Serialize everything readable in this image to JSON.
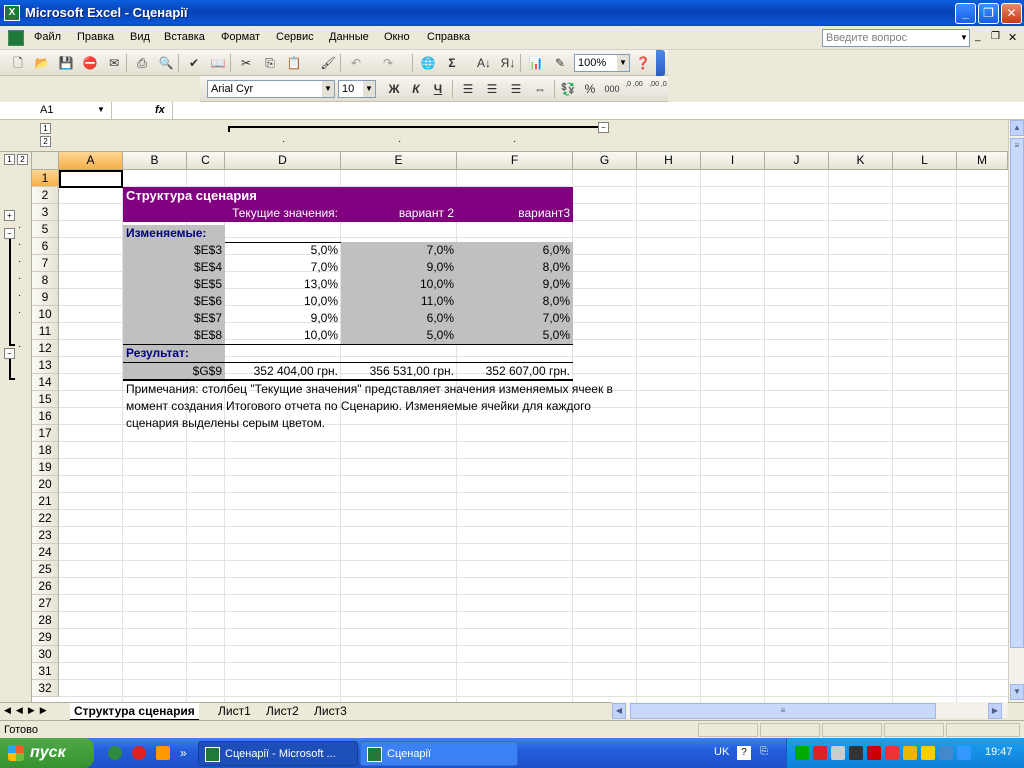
{
  "window": {
    "title": "Microsoft Excel - Сценарії",
    "app_icon": "excel-icon",
    "minimize": "_",
    "restore": "❐",
    "close": "✕"
  },
  "menu": {
    "items": [
      "Файл",
      "Правка",
      "Вид",
      "Вставка",
      "Формат",
      "Сервис",
      "Данные",
      "Окно",
      "Справка"
    ],
    "ask_placeholder": "Введите вопрос"
  },
  "toolbar": {
    "zoom": "100%",
    "font": "Arial Cyr",
    "size": "10",
    "bold": "Ж",
    "italic": "К",
    "underline": "Ч",
    "percent": "%",
    "thousands": "000",
    "inc_decimal": ",0 ,00",
    "dec_decimal": ",00 ,0",
    "sum": "Σ"
  },
  "formula_bar": {
    "name_box": "A1",
    "fx": "fx",
    "content": ""
  },
  "outline": {
    "levels_rows": [
      "1",
      "2"
    ],
    "levels_cols": [
      "1",
      "2"
    ],
    "expand": "+",
    "collapse": "−"
  },
  "columns": [
    "A",
    "B",
    "C",
    "D",
    "E",
    "F",
    "G",
    "H",
    "I",
    "J",
    "K",
    "L",
    "M"
  ],
  "rows": [
    "1",
    "2",
    "3",
    "5",
    "6",
    "7",
    "8",
    "9",
    "10",
    "11",
    "12",
    "13",
    "14",
    "15",
    "16",
    "17",
    "18",
    "19",
    "20",
    "21",
    "22",
    "23",
    "24",
    "25",
    "26",
    "27",
    "28",
    "29",
    "30",
    "31",
    "32"
  ],
  "sheet": {
    "title": "Структура сценария",
    "headers": [
      "Текущие значения:",
      "вариант 2",
      "вариант3"
    ],
    "changing_label": "Изменяемые:",
    "changing": [
      {
        "cell": "$E$3",
        "current": "5,0%",
        "v2": "7,0%",
        "v3": "6,0%"
      },
      {
        "cell": "$E$4",
        "current": "7,0%",
        "v2": "9,0%",
        "v3": "8,0%"
      },
      {
        "cell": "$E$5",
        "current": "13,0%",
        "v2": "10,0%",
        "v3": "9,0%"
      },
      {
        "cell": "$E$6",
        "current": "10,0%",
        "v2": "11,0%",
        "v3": "8,0%"
      },
      {
        "cell": "$E$7",
        "current": "9,0%",
        "v2": "6,0%",
        "v3": "7,0%"
      },
      {
        "cell": "$E$8",
        "current": "10,0%",
        "v2": "5,0%",
        "v3": "5,0%"
      }
    ],
    "result_label": "Результат:",
    "result": {
      "cell": "$G$9",
      "current": "352 404,00 грн.",
      "v2": "356 531,00 грн.",
      "v3": "352 607,00 грн."
    },
    "notes": [
      "Примечания: столбец \"Текущие значения\" представляет значения изменяемых ячеек в",
      "момент создания Итогового отчета по Сценарию. Изменяемые ячейки для каждого",
      "сценария выделены серым цветом."
    ]
  },
  "tabs": [
    "Структура сценария",
    "Лист1",
    "Лист2",
    "Лист3"
  ],
  "status": "Готово",
  "taskbar": {
    "start": "пуск",
    "tasks": [
      "Сценарії - Microsoft ...",
      "Сценарії"
    ],
    "lang": "UK",
    "clock": "19:47"
  },
  "colors": {
    "purple": "#800080",
    "gray": "#c0c0c0",
    "label_blue": "#000080",
    "selection": "#f4b04a"
  }
}
